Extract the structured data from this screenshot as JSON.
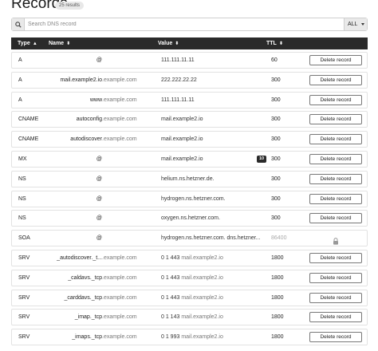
{
  "page": {
    "title": "Records",
    "results_badge": "25 results"
  },
  "search": {
    "placeholder": "Search DNS record",
    "filter_value": "ALL"
  },
  "table": {
    "headers": {
      "type": "Type",
      "name": "Name",
      "value": "Value",
      "ttl": "TTL"
    },
    "delete_label": "Delete record",
    "rows": [
      {
        "type": "A",
        "name": "@",
        "zone": "",
        "value": "111.111.11.11",
        "value_zone": "",
        "prio": "",
        "ttl": "60",
        "action": "delete"
      },
      {
        "type": "A",
        "name": "mail.example2.io",
        "zone": ".example.com",
        "value": "222.222.22.22",
        "value_zone": "",
        "prio": "",
        "ttl": "300",
        "action": "delete"
      },
      {
        "type": "A",
        "name": "www",
        "zone": ".example.com",
        "value": "111.111.11.11",
        "value_zone": "",
        "prio": "",
        "ttl": "300",
        "action": "delete"
      },
      {
        "type": "CNAME",
        "name": "autoconfig",
        "zone": ".example.com",
        "value": "mail.example2.io",
        "value_zone": "",
        "prio": "",
        "ttl": "300",
        "action": "delete"
      },
      {
        "type": "CNAME",
        "name": "autodiscover",
        "zone": ".example.com",
        "value": "mail.example2.io",
        "value_zone": "",
        "prio": "",
        "ttl": "300",
        "action": "delete"
      },
      {
        "type": "MX",
        "name": "@",
        "zone": "",
        "value": "mail.example2.io",
        "value_zone": "",
        "prio": "10",
        "ttl": "300",
        "action": "delete"
      },
      {
        "type": "NS",
        "name": "@",
        "zone": "",
        "value": "helium.ns.hetzner.de.",
        "value_zone": "",
        "prio": "",
        "ttl": "300",
        "action": "delete"
      },
      {
        "type": "NS",
        "name": "@",
        "zone": "",
        "value": "hydrogen.ns.hetzner.com.",
        "value_zone": "",
        "prio": "",
        "ttl": "300",
        "action": "delete"
      },
      {
        "type": "NS",
        "name": "@",
        "zone": "",
        "value": "oxygen.ns.hetzner.com.",
        "value_zone": "",
        "prio": "",
        "ttl": "300",
        "action": "delete"
      },
      {
        "type": "SOA",
        "name": "@",
        "zone": "",
        "value": "hydrogen.ns.hetzner.com. dns.hetzner...",
        "value_zone": "",
        "prio": "",
        "ttl": "86400",
        "action": "locked"
      },
      {
        "type": "SRV",
        "name": "_autodiscover._t...",
        "zone": ".example.com",
        "value": "0 1 443 ",
        "value_zone": "mail.example2.io",
        "prio": "",
        "ttl": "1800",
        "action": "delete"
      },
      {
        "type": "SRV",
        "name": "_caldavs._tcp",
        "zone": ".example.com",
        "value": "0 1 443 ",
        "value_zone": "mail.example2.io",
        "prio": "",
        "ttl": "1800",
        "action": "delete"
      },
      {
        "type": "SRV",
        "name": "_carddavs._tcp",
        "zone": ".example.com",
        "value": "0 1 443 ",
        "value_zone": "mail.example2.io",
        "prio": "",
        "ttl": "1800",
        "action": "delete"
      },
      {
        "type": "SRV",
        "name": "_imap._tcp",
        "zone": ".example.com",
        "value": "0 1 143 ",
        "value_zone": "mail.example2.io",
        "prio": "",
        "ttl": "1800",
        "action": "delete"
      },
      {
        "type": "SRV",
        "name": "_imaps._tcp",
        "zone": ".example.com",
        "value": "0 1 993 ",
        "value_zone": "mail.example2.io",
        "prio": "",
        "ttl": "1800",
        "action": "delete"
      }
    ]
  }
}
